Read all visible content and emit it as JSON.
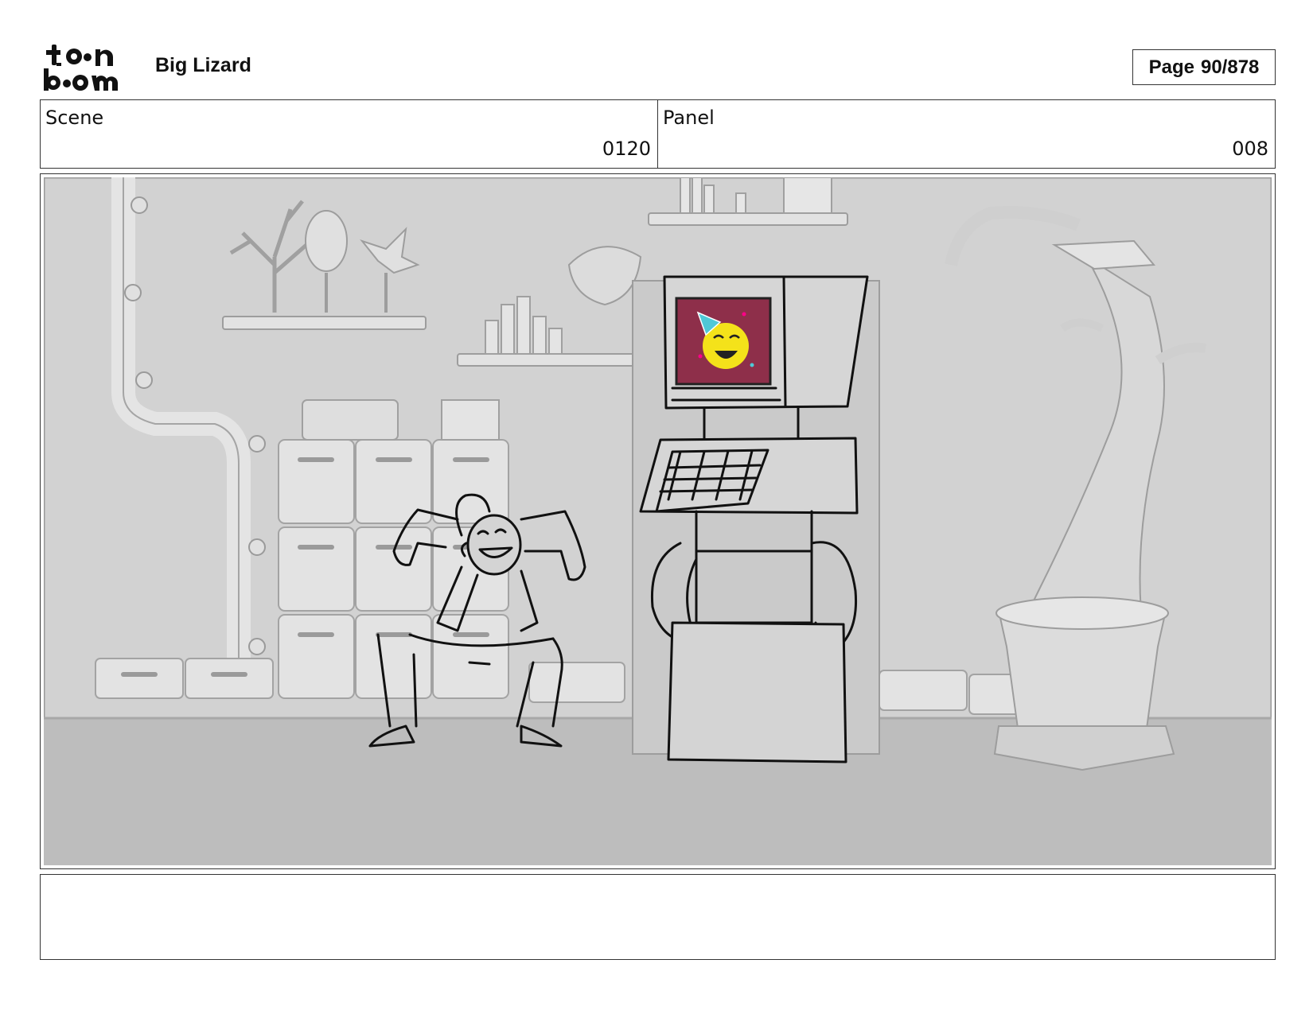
{
  "header": {
    "logo_top": "to n",
    "logo_bottom": "b m",
    "project_title": "Big Lizard",
    "page_label": "Page",
    "page_number": "90/878"
  },
  "scene": {
    "label": "Scene",
    "value": "0120"
  },
  "panel": {
    "label": "Panel",
    "value": "008"
  },
  "artwork": {
    "description_icons": [
      "lab-background",
      "boy-sketch",
      "robot-computer",
      "party-emoji-screen",
      "potted-tree"
    ],
    "colors": {
      "screen": "#8e2f4a",
      "emoji": "#f4e21a",
      "party_hat": "#4fc8d6",
      "background": "#cfcfcf"
    }
  },
  "notes": {
    "text": ""
  }
}
